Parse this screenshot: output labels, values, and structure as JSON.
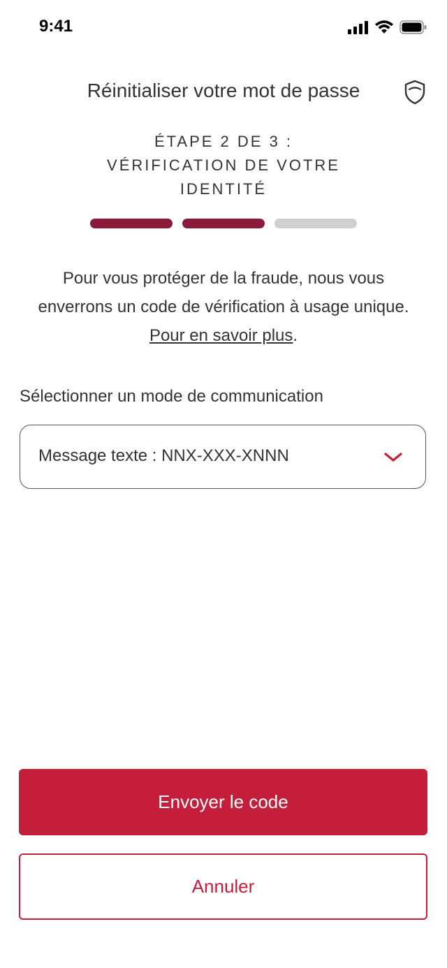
{
  "status_bar": {
    "time": "9:41",
    "icons": [
      "cellular-signal-icon",
      "wifi-icon",
      "battery-icon"
    ]
  },
  "header": {
    "title": "Réinitialiser votre mot de passe",
    "security_icon": "shield-icon"
  },
  "step": {
    "line1": "ÉTAPE 2 DE 3 :",
    "line2": "VÉRIFICATION DE VOTRE IDENTITÉ",
    "current": 2,
    "total": 3
  },
  "intro": {
    "text": "Pour vous protéger de la fraude, nous vous enverrons un code de vérification à usage unique.",
    "link": "Pour en savoir plus",
    "suffix": "."
  },
  "communication": {
    "label": "Sélectionner un mode de communication",
    "selected": "Message texte : NNX-XXX-XNNN",
    "dropdown_icon": "chevron-down-icon"
  },
  "actions": {
    "send_label": "Envoyer le code",
    "cancel_label": "Annuler"
  },
  "colors": {
    "primary": "#c41e3a",
    "progress_done": "#8c1a3c",
    "progress_todo": "#d0d0d0",
    "text": "#333333"
  }
}
